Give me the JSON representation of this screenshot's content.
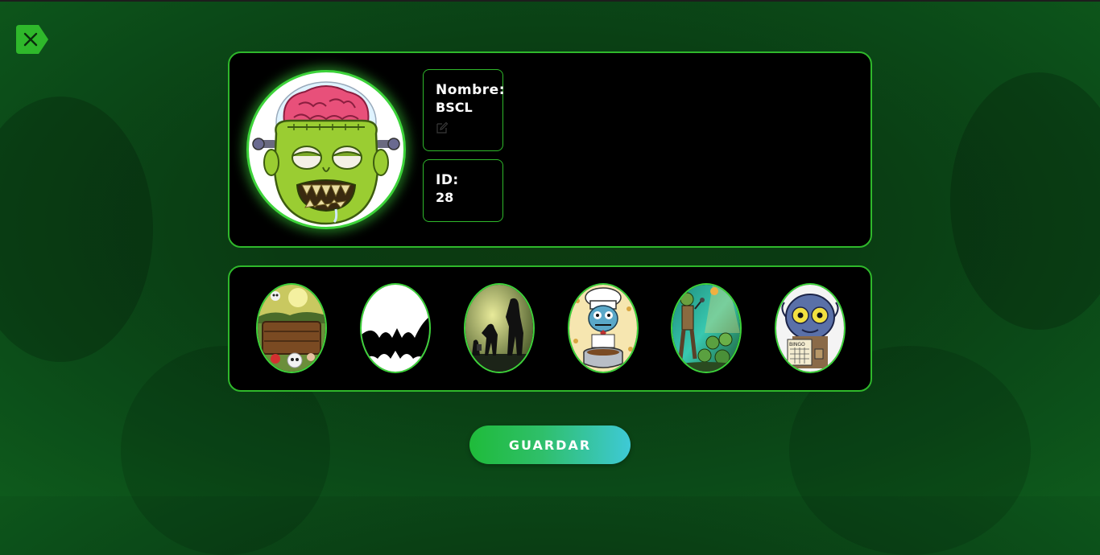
{
  "close": {
    "icon": "close-icon"
  },
  "profile": {
    "avatar": {
      "icon": "zombie-brain-avatar"
    },
    "name_label": "Nombre:",
    "name_value": "BSCL",
    "edit_icon": "edit-icon",
    "id_label": "ID:",
    "id_value": "28"
  },
  "avatar_options": [
    {
      "icon": "graveyard-coffin-avatar"
    },
    {
      "icon": "bat-avatar"
    },
    {
      "icon": "zombie-silhouettes-avatar"
    },
    {
      "icon": "zombie-chef-avatar"
    },
    {
      "icon": "zombie-singer-avatar"
    },
    {
      "icon": "zombie-bingo-avatar"
    }
  ],
  "save_label": "GUARDAR",
  "colors": {
    "accent": "#2fb82b",
    "background": "#0b3f14",
    "save_gradient_start": "#1fbb3a",
    "save_gradient_end": "#3ec9d6"
  }
}
